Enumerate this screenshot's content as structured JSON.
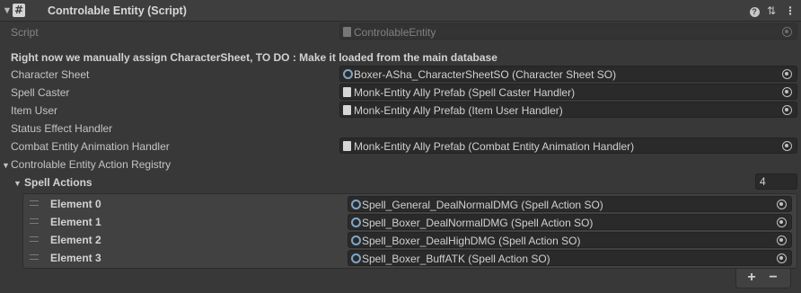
{
  "header": {
    "title": "Controlable Entity (Script)",
    "fold_glyph": "▼",
    "script_glyph": "#",
    "help_glyph": "?",
    "presets_glyph": "⇅",
    "menu_glyph": "⋮",
    "icons": [
      "fold-arrow-icon",
      "script-icon",
      "help-icon",
      "presets-icon",
      "kebab-menu-icon"
    ]
  },
  "script_row": {
    "label": "Script",
    "value": "ControlableEntity"
  },
  "note": "Right now we manually assign CharacterSheet, TO DO : Make it loaded from the main database",
  "fields": {
    "character_sheet": {
      "label": "Character Sheet",
      "value": "Boxer-ASha_CharacterSheetSO (Character Sheet SO)"
    },
    "spell_caster": {
      "label": "Spell Caster",
      "value": "Monk-Entity Ally Prefab (Spell Caster Handler)"
    },
    "item_user": {
      "label": "Item User",
      "value": "Monk-Entity Ally Prefab (Item User Handler)"
    },
    "status_effect": {
      "label": "Status Effect Handler"
    },
    "combat_anim": {
      "label": "Combat Entity Animation Handler",
      "value": "Monk-Entity Ally Prefab (Combat Entity Animation Handler)"
    }
  },
  "registry": {
    "label": "Controlable Entity Action Registry",
    "spell_actions": {
      "label": "Spell Actions",
      "size": "4",
      "elements": [
        {
          "label": "Element 0",
          "value": "Spell_General_DealNormalDMG (Spell Action SO)"
        },
        {
          "label": "Element 1",
          "value": "Spell_Boxer_DealNormalDMG (Spell Action SO)"
        },
        {
          "label": "Element 2",
          "value": "Spell_Boxer_DealHighDMG (Spell Action SO)"
        },
        {
          "label": "Element 3",
          "value": "Spell_Boxer_BuffATK (Spell Action SO)"
        }
      ],
      "add_label": "+",
      "remove_label": "−"
    }
  },
  "colors": {
    "background": "#383838",
    "field": "#2a2a2a",
    "so_icon": "#7fa6c7"
  }
}
